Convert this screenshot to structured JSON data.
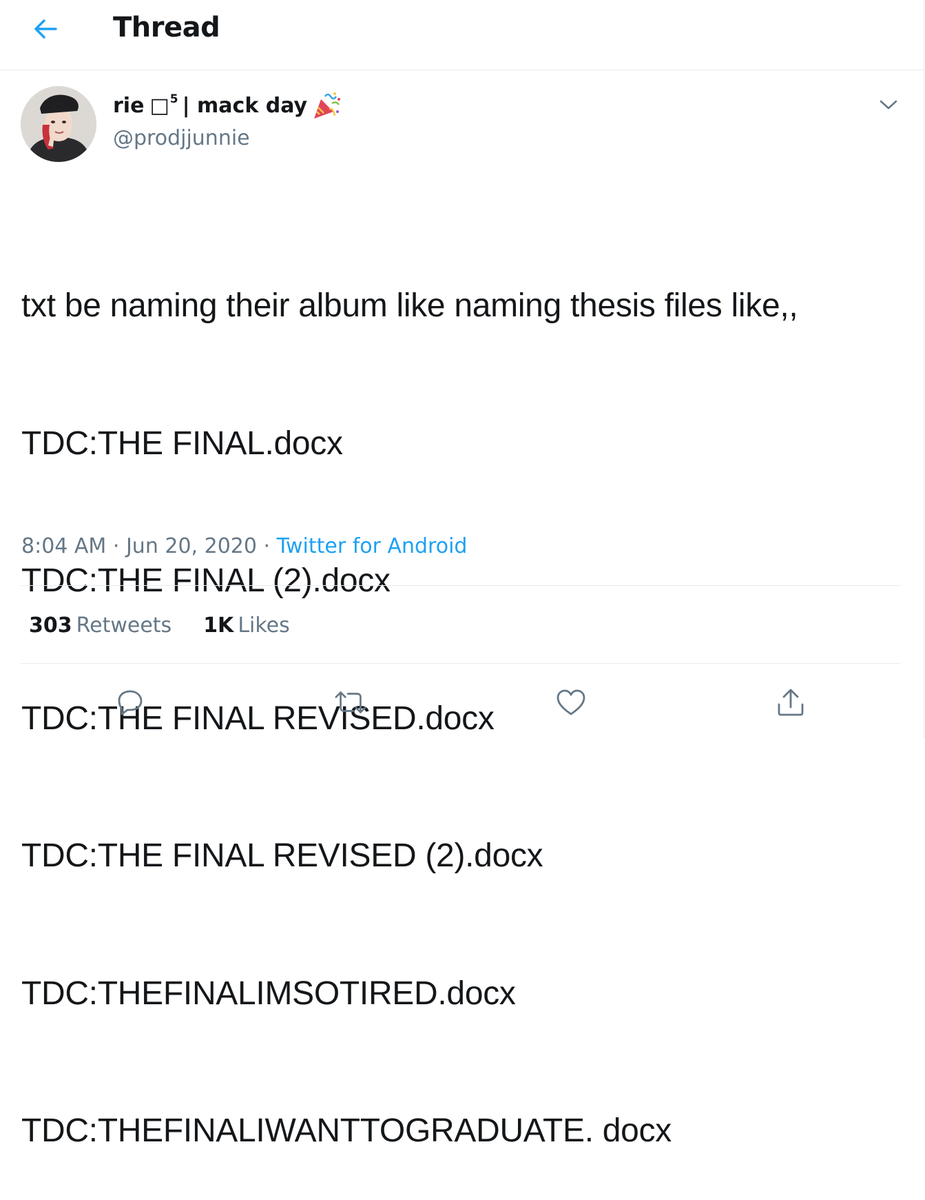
{
  "header": {
    "title": "Thread",
    "back_icon": "arrow-left-icon"
  },
  "author": {
    "display_name": "rie",
    "name_glyph": "□",
    "name_superscript": "5",
    "name_suffix": "| mack day",
    "name_emoji": "party-popper-icon",
    "handle": "@prodjjunnie"
  },
  "tweet": {
    "lines": [
      "txt be naming their album like naming thesis files like,,",
      "TDC:THE FINAL.docx",
      "TDC:THE FINAL (2).docx",
      "TDC:THE FINAL REVISED.docx",
      "TDC:THE FINAL REVISED (2).docx",
      "TDC:THEFINALIMSOTIRED.docx",
      "TDC:THEFINALIWANTTOGRADUATE. docx"
    ],
    "time": "8:04 AM",
    "date": "Jun 20, 2020",
    "separator": "·",
    "source": "Twitter for Android"
  },
  "stats": {
    "retweets_count": "303",
    "retweets_label": "Retweets",
    "likes_count": "1K",
    "likes_label": "Likes"
  },
  "actions": {
    "reply_icon": "reply-icon",
    "retweet_icon": "retweet-icon",
    "like_icon": "heart-icon",
    "share_icon": "share-icon"
  },
  "colors": {
    "accent": "#1da1f2",
    "text": "#14171a",
    "secondary": "#657786",
    "border": "#e6ecf0"
  }
}
